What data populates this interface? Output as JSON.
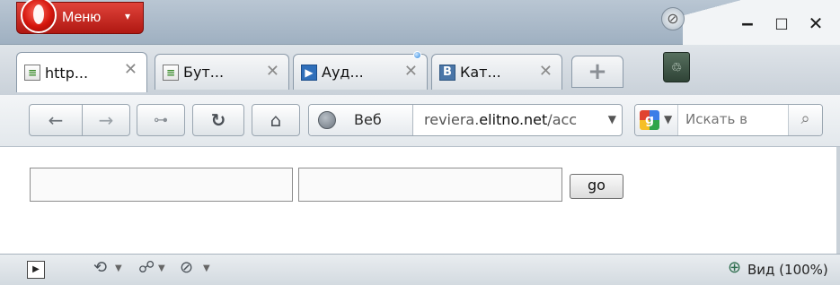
{
  "titlebar": {
    "menu_label": "Меню",
    "menu_caret": "▾",
    "window_buttons": {
      "minimize": "‒",
      "maximize": "□",
      "close": "✕"
    }
  },
  "tabs": [
    {
      "title": "http...",
      "icon": "page-icon",
      "active": true,
      "close": "✕"
    },
    {
      "title": "Бут...",
      "icon": "page-icon",
      "active": false,
      "close": "✕"
    },
    {
      "title": "Ауд...",
      "icon": "audio-play-icon",
      "active": false,
      "close": "✕"
    },
    {
      "title": "Кат...",
      "icon": "vk-icon",
      "icon_text": "В",
      "active": false,
      "close": "✕"
    }
  ],
  "new_tab": "+",
  "toolbar": {
    "back": "←",
    "forward": "→",
    "wand": "⊶",
    "reload": "↻",
    "home": "⌂",
    "address_badge": "Веб",
    "url_host_prefix": "reviera.",
    "url_host_main": "elitno.net",
    "url_path": "/acc",
    "search_engine_letter": "g",
    "search_placeholder": "Искать в",
    "search_button": "⌕"
  },
  "content": {
    "field_1_value": "",
    "field_2_value": "",
    "go_label": "go"
  },
  "statusbar": {
    "zoom_label": "Вид (100%)"
  },
  "colors": {
    "menu_red": "#c8231a",
    "titlebar": "#a9b8c7",
    "toolbar": "#e8ecef",
    "statusbar": "#dde3e8"
  }
}
